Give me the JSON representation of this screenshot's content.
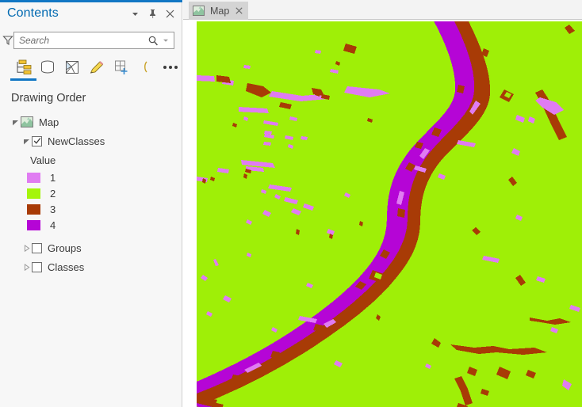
{
  "panel": {
    "title": "Contents",
    "menu_icon": "chevron-down-icon",
    "pin_icon": "pin-icon",
    "close_icon": "close-icon"
  },
  "search": {
    "placeholder": "Search",
    "value": "",
    "filter_icon": "filter-funnel-icon",
    "search_icon": "magnifier-icon",
    "dropdown_icon": "chevron-down-small-icon"
  },
  "toolbar": {
    "items": [
      {
        "name": "list-by-drawing-order-icon",
        "label": "List By Drawing Order",
        "selected": true
      },
      {
        "name": "list-by-data-source-icon",
        "label": "List By Data Source",
        "selected": false
      },
      {
        "name": "list-by-selection-icon",
        "label": "List By Selection",
        "selected": false
      },
      {
        "name": "list-by-editing-icon",
        "label": "List By Editing",
        "selected": false
      },
      {
        "name": "list-by-snapping-icon",
        "label": "List By Snapping",
        "selected": false
      },
      {
        "name": "list-by-labeling-icon",
        "label": "List By Labeling",
        "selected": false
      },
      {
        "name": "more-options-icon",
        "label": "More",
        "selected": false
      }
    ]
  },
  "tree": {
    "heading": "Drawing Order",
    "map_node": {
      "label": "Map",
      "expanded": true,
      "icon": "map-layer-icon"
    },
    "layer": {
      "label": "NewClasses",
      "expanded": true,
      "checked": true
    },
    "legend": {
      "heading": "Value",
      "entries": [
        {
          "value": "1",
          "color": "#e07cf2"
        },
        {
          "value": "2",
          "color": "#a5f50b"
        },
        {
          "value": "3",
          "color": "#a83b06"
        },
        {
          "value": "4",
          "color": "#b505d6"
        }
      ]
    },
    "groups_node": {
      "label": "Groups",
      "expanded": false,
      "checked": false
    },
    "classes_node": {
      "label": "Classes",
      "expanded": false,
      "checked": false
    }
  },
  "map_view": {
    "tab_label": "Map",
    "tab_icon": "map-layer-icon",
    "tab_close_icon": "close-icon",
    "background_color": "#9fef07",
    "classes": {
      "class1_color": "#e07cf2",
      "class2_color": "#9fef07",
      "class3_color": "#a83b06",
      "class4_color": "#b505d6"
    }
  }
}
